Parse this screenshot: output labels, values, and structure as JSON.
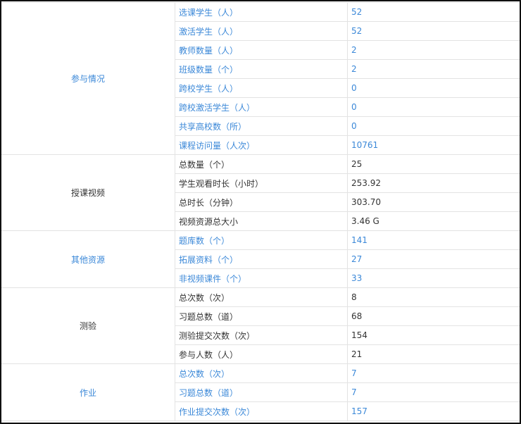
{
  "sections": [
    {
      "title": "参与情况",
      "color": "blue",
      "rows": [
        {
          "label": "选课学生（人）",
          "value": "52"
        },
        {
          "label": "激活学生（人）",
          "value": "52"
        },
        {
          "label": "教师数量（人）",
          "value": "2"
        },
        {
          "label": "班级数量（个）",
          "value": "2"
        },
        {
          "label": "跨校学生（人）",
          "value": "0"
        },
        {
          "label": "跨校激活学生（人）",
          "value": "0"
        },
        {
          "label": "共享高校数（所）",
          "value": "0"
        },
        {
          "label": "课程访问量（人次）",
          "value": "10761"
        }
      ]
    },
    {
      "title": "授课视频",
      "color": "dark",
      "rows": [
        {
          "label": "总数量（个）",
          "value": "25"
        },
        {
          "label": "学生观看时长（小时）",
          "value": "253.92"
        },
        {
          "label": "总时长（分钟）",
          "value": "303.70"
        },
        {
          "label": "视频资源总大小",
          "value": "3.46 G"
        }
      ]
    },
    {
      "title": "其他资源",
      "color": "blue",
      "rows": [
        {
          "label": "题库数（个）",
          "value": "141"
        },
        {
          "label": "拓展资料（个）",
          "value": "27"
        },
        {
          "label": "非视频课件（个）",
          "value": "33"
        }
      ]
    },
    {
      "title": "测验",
      "color": "dark",
      "rows": [
        {
          "label": "总次数（次）",
          "value": "8"
        },
        {
          "label": "习题总数（道）",
          "value": "68"
        },
        {
          "label": "测验提交次数（次）",
          "value": "154"
        },
        {
          "label": "参与人数（人）",
          "value": "21"
        }
      ]
    },
    {
      "title": "作业",
      "color": "blue",
      "rows": [
        {
          "label": "总次数（次）",
          "value": "7"
        },
        {
          "label": "习题总数（道）",
          "value": "7"
        },
        {
          "label": "作业提交次数（次）",
          "value": "157"
        }
      ]
    }
  ]
}
